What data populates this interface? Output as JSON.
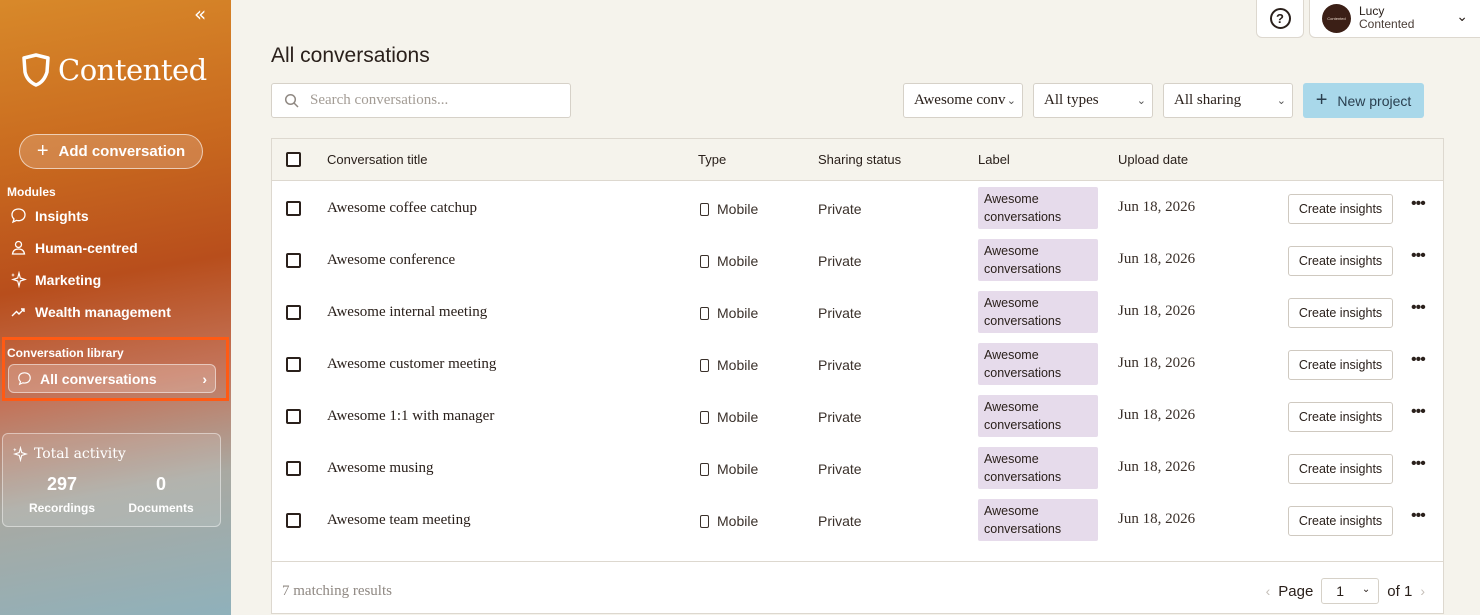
{
  "sidebar": {
    "collapse_glyph": "«",
    "brand": "Contented",
    "add_conversation": "Add conversation",
    "modules_title": "Modules",
    "modules": [
      {
        "label": "Insights",
        "icon": "chat-bubble-icon"
      },
      {
        "label": "Human-centred",
        "icon": "person-icon"
      },
      {
        "label": "Marketing",
        "icon": "sparkle-icon"
      },
      {
        "label": "Wealth management",
        "icon": "trend-icon"
      }
    ],
    "library_title": "Conversation library",
    "all_conversations": "All conversations",
    "activity": {
      "title": "Total activity",
      "recordings_count": "297",
      "recordings_label": "Recordings",
      "documents_count": "0",
      "documents_label": "Documents"
    }
  },
  "header": {
    "help_glyph": "?",
    "user_name": "Lucy",
    "user_org": "Contented",
    "avatar_text": "Contented"
  },
  "main": {
    "title": "All conversations",
    "search_placeholder": "Search conversations...",
    "filters": {
      "label_value": "Awesome conv",
      "type_value": "All types",
      "sharing_value": "All sharing"
    },
    "new_project": "New project",
    "columns": {
      "title": "Conversation title",
      "type": "Type",
      "sharing": "Sharing status",
      "label": "Label",
      "date": "Upload date"
    },
    "rows": [
      {
        "title": "Awesome coffee catchup",
        "type": "Mobile",
        "sharing": "Private",
        "label": "Awesome conversations",
        "date": "Jun 18, 2026",
        "action": "Create insights"
      },
      {
        "title": "Awesome conference",
        "type": "Mobile",
        "sharing": "Private",
        "label": "Awesome conversations",
        "date": "Jun 18, 2026",
        "action": "Create insights"
      },
      {
        "title": "Awesome internal meeting",
        "type": "Mobile",
        "sharing": "Private",
        "label": "Awesome conversations",
        "date": "Jun 18, 2026",
        "action": "Create insights"
      },
      {
        "title": "Awesome customer meeting",
        "type": "Mobile",
        "sharing": "Private",
        "label": "Awesome conversations",
        "date": "Jun 18, 2026",
        "action": "Create insights"
      },
      {
        "title": "Awesome 1:1 with manager",
        "type": "Mobile",
        "sharing": "Private",
        "label": "Awesome conversations",
        "date": "Jun 18, 2026",
        "action": "Create insights"
      },
      {
        "title": "Awesome musing",
        "type": "Mobile",
        "sharing": "Private",
        "label": "Awesome conversations",
        "date": "Jun 18, 2026",
        "action": "Create insights"
      },
      {
        "title": "Awesome team meeting",
        "type": "Mobile",
        "sharing": "Private",
        "label": "Awesome conversations",
        "date": "Jun 18, 2026",
        "action": "Create insights"
      }
    ],
    "more_glyph": "•••",
    "footer": {
      "results": "7 matching results",
      "page_label": "Page",
      "page_value": "1",
      "of_label": "of 1"
    }
  },
  "colors": {
    "highlight": "#ff5a14",
    "primary_button": "#a9d8ea",
    "label_chip": "#e6dbeb"
  }
}
